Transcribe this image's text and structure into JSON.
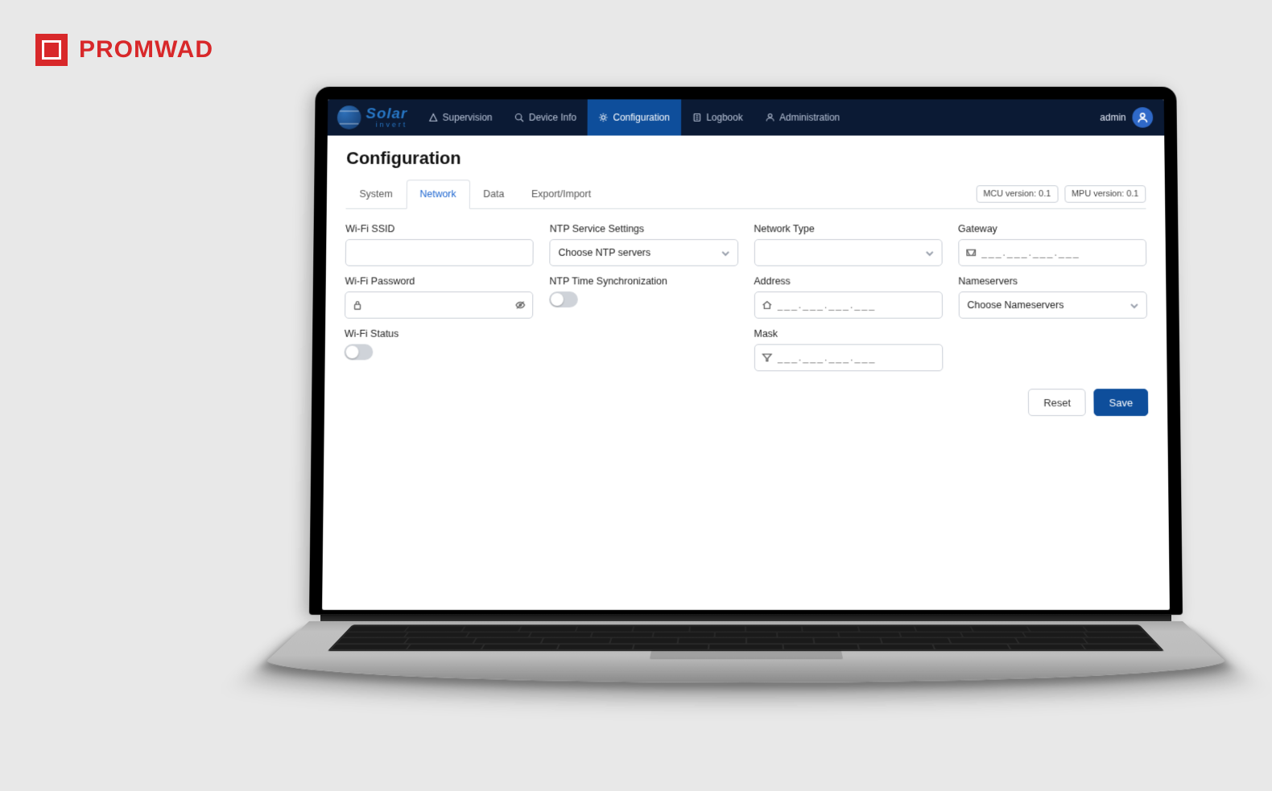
{
  "brand_outer": "PROMWAD",
  "brand_app": {
    "line1": "Solar",
    "line2": "invert"
  },
  "nav": {
    "items": [
      {
        "label": "Supervision"
      },
      {
        "label": "Device Info"
      },
      {
        "label": "Configuration"
      },
      {
        "label": "Logbook"
      },
      {
        "label": "Administration"
      }
    ],
    "user_label": "admin"
  },
  "page": {
    "title": "Configuration",
    "tabs": [
      {
        "label": "System"
      },
      {
        "label": "Network"
      },
      {
        "label": "Data"
      },
      {
        "label": "Export/Import"
      }
    ],
    "badges": {
      "mcu": "MCU version: 0.1",
      "mpu": "MPU version: 0.1"
    }
  },
  "form": {
    "wifi_ssid_label": "Wi-Fi SSID",
    "wifi_password_label": "Wi-Fi Password",
    "wifi_status_label": "Wi-Fi Status",
    "ntp_service_label": "NTP Service Settings",
    "ntp_service_placeholder": "Choose NTP servers",
    "ntp_sync_label": "NTP Time Synchronization",
    "network_type_label": "Network Type",
    "address_label": "Address",
    "mask_label": "Mask",
    "gateway_label": "Gateway",
    "nameservers_label": "Nameservers",
    "nameservers_placeholder": "Choose Nameservers",
    "mask_placeholder": "___.___.___.___"
  },
  "actions": {
    "reset": "Reset",
    "save": "Save"
  }
}
